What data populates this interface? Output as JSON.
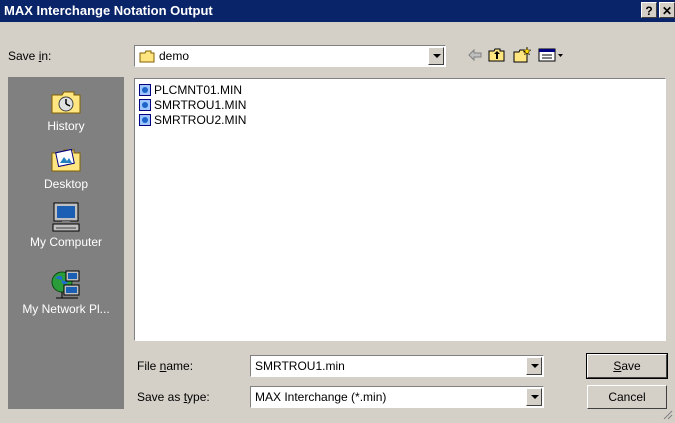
{
  "window": {
    "title": "MAX Interchange Notation Output",
    "help_glyph": "?",
    "close_glyph": "✕"
  },
  "save_in": {
    "label_pre": "Save ",
    "label_accel": "i",
    "label_post": "n:",
    "value": "demo",
    "icon": "folder-icon"
  },
  "toolbar": {
    "back_icon": "back-arrow-icon",
    "up_icon": "up-folder-icon",
    "new_folder_icon": "new-folder-icon",
    "views_icon": "views-menu-icon"
  },
  "places": [
    {
      "label": "History",
      "icon": "history-icon"
    },
    {
      "label": "Desktop",
      "icon": "desktop-icon"
    },
    {
      "label": "My Computer",
      "icon": "my-computer-icon"
    },
    {
      "label": "My Network Pl...",
      "icon": "network-places-icon"
    }
  ],
  "files": [
    {
      "name": "PLCMNT01.MIN"
    },
    {
      "name": "SMRTROU1.MIN"
    },
    {
      "name": "SMRTROU2.MIN"
    }
  ],
  "file_name": {
    "label_pre": "File ",
    "label_accel": "n",
    "label_post": "ame:",
    "value": "SMRTROU1.min"
  },
  "save_as_type": {
    "label_pre": "Save as ",
    "label_accel": "t",
    "label_post": "ype:",
    "value": "MAX Interchange (*.min)"
  },
  "buttons": {
    "save_accel": "S",
    "save_rest": "ave",
    "cancel": "Cancel"
  },
  "colors": {
    "titlebar": "#0a246a",
    "dialog": "#d4d0c8",
    "places_bar": "#808080"
  }
}
